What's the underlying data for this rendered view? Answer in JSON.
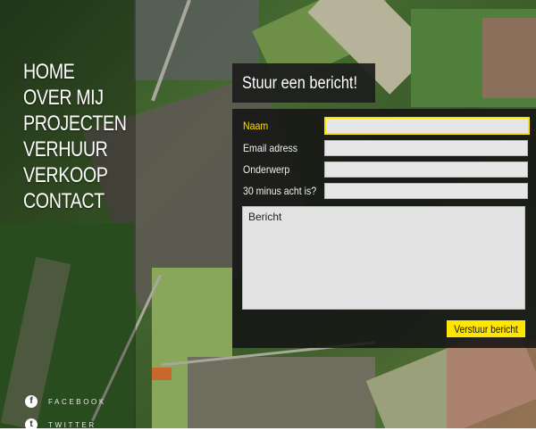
{
  "nav": {
    "items": [
      "HOME",
      "OVER MIJ",
      "PROJECTEN",
      "VERHUUR",
      "VERKOOP",
      "CONTACT"
    ]
  },
  "social": {
    "facebook": {
      "icon": "facebook-icon",
      "glyph": "f",
      "label": "FACEBOOK"
    },
    "twitter": {
      "icon": "twitter-icon",
      "glyph": "t",
      "label": "TWITTER"
    }
  },
  "contact": {
    "title": "Stuur een bericht!",
    "fields": {
      "name": {
        "label": "Naam",
        "value": ""
      },
      "email": {
        "label": "Email adress",
        "value": ""
      },
      "subject": {
        "label": "Onderwerp",
        "value": ""
      },
      "captcha": {
        "label": "30 minus acht is?",
        "value": ""
      }
    },
    "message_placeholder": "Bericht",
    "submit_label": "Verstuur bericht"
  },
  "colors": {
    "accent": "#ffe600",
    "panel": "#141414",
    "field": "#e6e6e6"
  }
}
